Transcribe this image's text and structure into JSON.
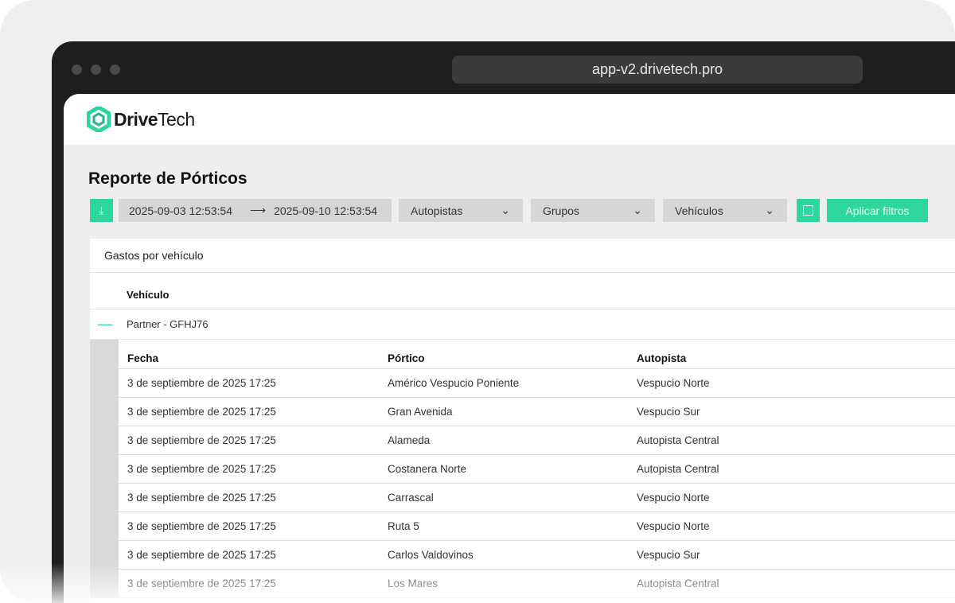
{
  "browser": {
    "url": "app-v2.drivetech.pro"
  },
  "brand": {
    "name_bold": "Drive",
    "name_light": "Tech",
    "accent": "#2dd69a"
  },
  "page": {
    "title": "Reporte de Pórticos"
  },
  "filters": {
    "date_from": "2025-09-03 12:53:54",
    "date_to": "2025-09-10 12:53:54",
    "autopistas": "Autopistas",
    "grupos": "Grupos",
    "vehiculos": "Vehículos",
    "apply_label": "Aplicar filtros"
  },
  "card": {
    "title": "Gastos por vehículo",
    "vehicle_header": "Vehículo",
    "vehicle": "Partner - GFHJ76",
    "columns": [
      "Fecha",
      "Pórtico",
      "Autopista"
    ],
    "rows": [
      [
        "3 de septiembre de 2025 17:25",
        "Américo Vespucio Poniente",
        "Vespucio Norte"
      ],
      [
        "3 de septiembre de 2025 17:25",
        "Gran Avenida",
        "Vespucio Sur"
      ],
      [
        "3 de septiembre de 2025 17:25",
        "Alameda",
        "Autopista Central"
      ],
      [
        "3 de septiembre de 2025 17:25",
        "Costanera Norte",
        "Autopista Central"
      ],
      [
        "3 de septiembre de 2025 17:25",
        "Carrascal",
        "Vespucio Norte"
      ],
      [
        "3 de septiembre de 2025 17:25",
        "Ruta 5",
        "Vespucio Norte"
      ],
      [
        "3 de septiembre de 2025 17:25",
        "Carlos Valdovinos",
        "Vespucio Sur"
      ],
      [
        "3 de septiembre de 2025 17:25",
        "Los Mares",
        "Autopista Central"
      ]
    ]
  }
}
